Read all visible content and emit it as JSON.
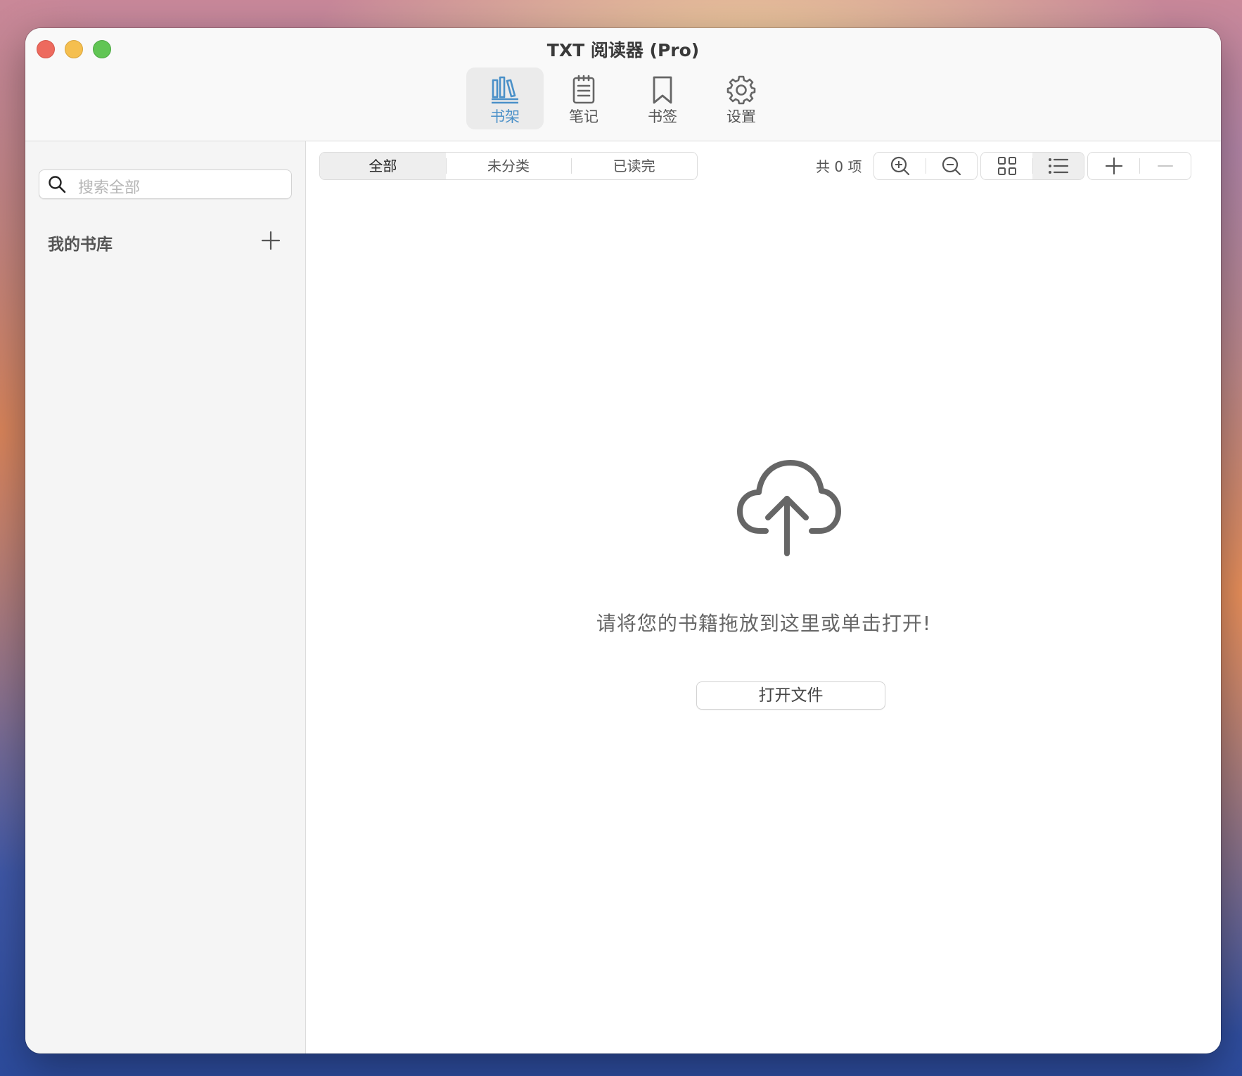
{
  "window": {
    "title": "TXT 阅读器 (Pro)"
  },
  "toolbar": {
    "items": [
      {
        "label": "书架",
        "icon": "bookshelf-icon",
        "active": true
      },
      {
        "label": "笔记",
        "icon": "notes-icon"
      },
      {
        "label": "书签",
        "icon": "bookmark-icon"
      },
      {
        "label": "设置",
        "icon": "gear-icon"
      }
    ]
  },
  "sidebar": {
    "search_placeholder": "搜索全部",
    "library_title": "我的书库"
  },
  "main": {
    "tabs": [
      {
        "label": "全部",
        "active": true
      },
      {
        "label": "未分类"
      },
      {
        "label": "已读完"
      }
    ],
    "count_text": "共 0 项",
    "empty_text": "请将您的书籍拖放到这里或单击打开!",
    "open_button": "打开文件"
  },
  "colors": {
    "accent": "#4a90c8",
    "icon_gray": "#666666"
  }
}
